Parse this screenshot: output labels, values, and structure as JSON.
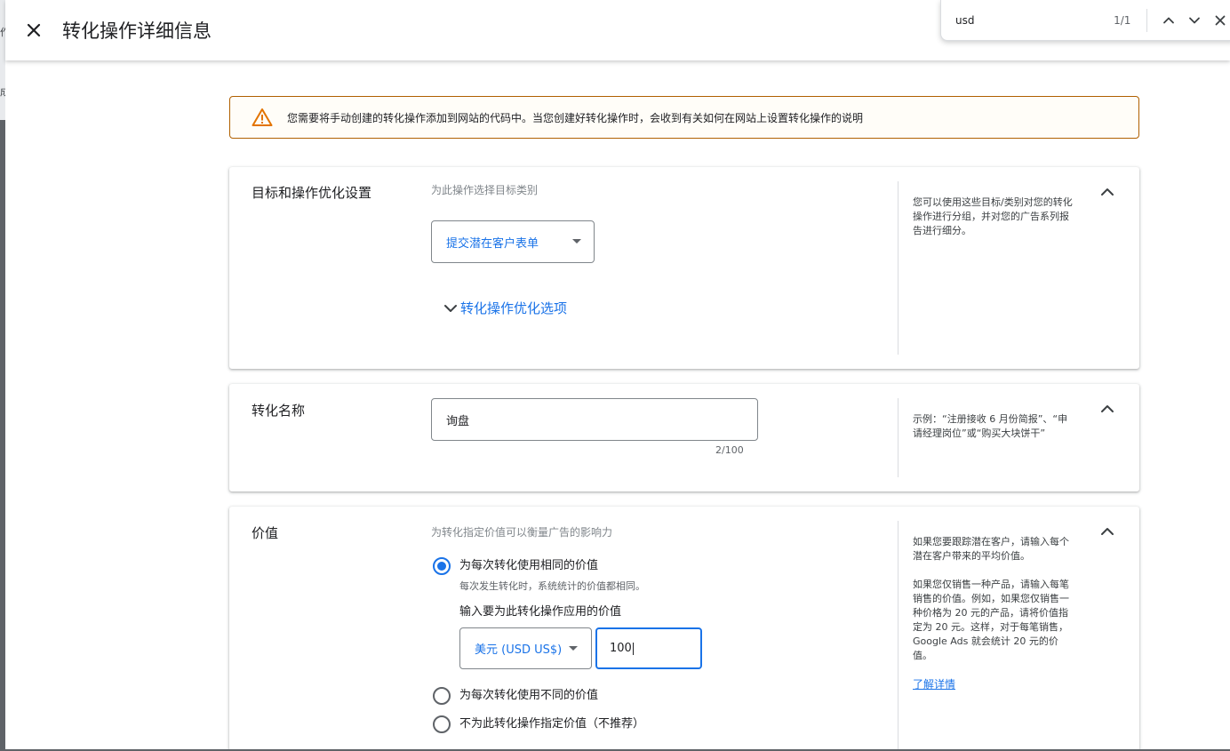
{
  "header": {
    "title": "转化操作详细信息"
  },
  "underlying": {
    "frag1": "作",
    "frag2": "成"
  },
  "findbar": {
    "query": "usd",
    "count": "1/1"
  },
  "warning": {
    "text": "您需要将手动创建的转化操作添加到网站的代码中。当您创建好转化操作时，会收到有关如何在网站上设置转化操作的说明"
  },
  "goal_card": {
    "title": "目标和操作优化设置",
    "sublabel": "为此操作选择目标类别",
    "category": "提交潜在客户表单",
    "expander": "转化操作优化选项",
    "help": "您可以使用这些目标/类别对您的转化操作进行分组，并对您的广告系列报告进行细分。"
  },
  "name_card": {
    "title": "转化名称",
    "value": "询盘",
    "counter": "2/100",
    "help": "示例：“注册接收 6 月份简报”、“申请经理岗位”或“购买大块饼干”"
  },
  "value_card": {
    "title": "价值",
    "sublabel": "为转化指定价值可以衡量广告的影响力",
    "options": [
      {
        "label": "为每次转化使用相同的价值",
        "desc": "每次发生转化时，系统统计的价值都相同。",
        "selected": true
      },
      {
        "label": "为每次转化使用不同的价值",
        "selected": false
      },
      {
        "label": "不为此转化操作指定价值（不推荐）",
        "selected": false
      }
    ],
    "input_label": "输入要为此转化操作应用的价值",
    "currency": "美元 (USD US$)",
    "amount": "100",
    "help1": "如果您要跟踪潜在客户，请输入每个潜在客户带来的平均价值。",
    "help2": "如果您仅销售一种产品，请输入每笔销售的价值。例如，如果您仅销售一种价格为 20 元的产品，请将价值指定为 20 元。这样，对于每笔销售，Google Ads 就会统计 20 元的价值。",
    "help_link": "了解详情"
  },
  "colors": {
    "accent": "#1a73e8",
    "warning_border": "#b06000",
    "warning_icon": "#e37400"
  }
}
